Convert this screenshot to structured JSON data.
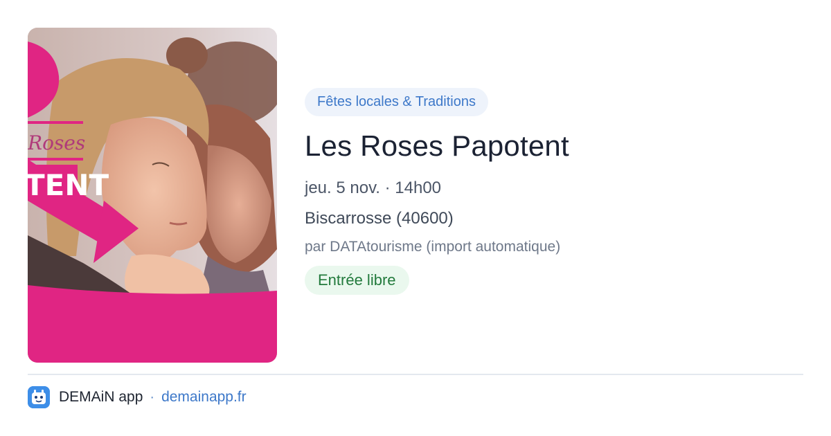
{
  "event": {
    "category": "Fêtes locales & Traditions",
    "title": "Les Roses Papotent",
    "date_time": "jeu. 5 nov. · 14h00",
    "location": "Biscarrosse (40600)",
    "source": "par DATAtourisme (import automatique)",
    "price": "Entrée libre",
    "poster_text": [
      "Roses",
      "TENT"
    ]
  },
  "footer": {
    "app_name": "DEMAiN app",
    "separator": "·",
    "domain": "demainapp.fr"
  },
  "colors": {
    "accent_blue": "#3d78c9",
    "category_bg": "#eef3fb",
    "price_green": "#227a3c",
    "price_bg": "#eaf8ee",
    "poster_pink": "#e02583",
    "logo_blue": "#3d8ee8"
  }
}
